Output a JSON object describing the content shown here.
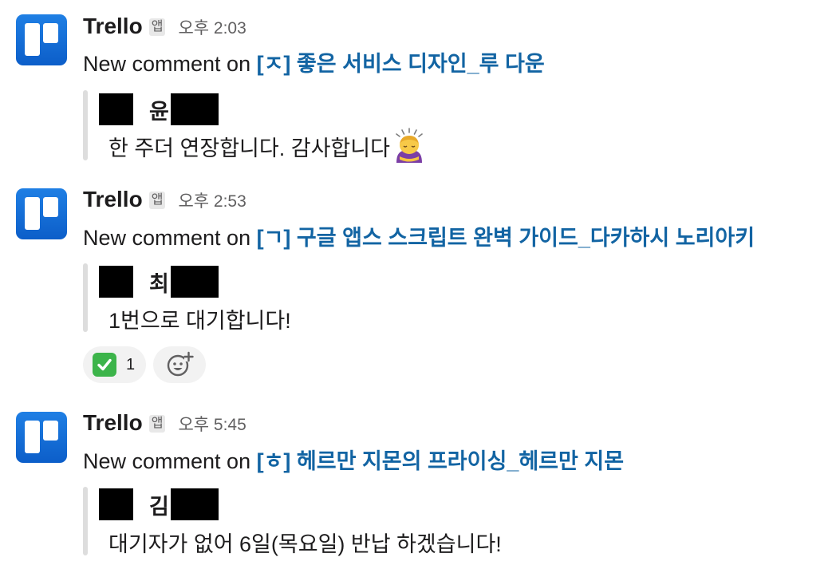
{
  "messages": [
    {
      "sender": "Trello",
      "app_badge": "앱",
      "time": "오후 2:03",
      "prefix": "New comment on ",
      "card_title": "[ㅈ] 좋은 서비스 디자인_루 다운",
      "author_name": "윤",
      "comment": "한 주더 연장합니다. 감사합니다",
      "emoji": "person-bowing-emoji"
    },
    {
      "sender": "Trello",
      "app_badge": "앱",
      "time": "오후 2:53",
      "prefix": "New comment on ",
      "card_title": "[ㄱ] 구글 앱스 스크립트 완벽 가이드_다카하시 노리아키",
      "author_name": "최",
      "comment": "1번으로 대기합니다!",
      "reactions": [
        {
          "icon": "white-check-mark-emoji",
          "count": "1"
        }
      ],
      "add_reaction_icon": "add-reaction-icon"
    },
    {
      "sender": "Trello",
      "app_badge": "앱",
      "time": "오후 5:45",
      "prefix": "New comment on ",
      "card_title": "[ㅎ] 헤르만 지몬의 프라이싱_헤르만 지몬",
      "author_name": "김",
      "comment": "대기자가 없어 6일(목요일) 반납 하겠습니다!"
    }
  ],
  "colors": {
    "link": "#1264a3",
    "trello_blue": "#0c5ec9",
    "quote_bar": "#dddddd",
    "muted": "#616061"
  }
}
